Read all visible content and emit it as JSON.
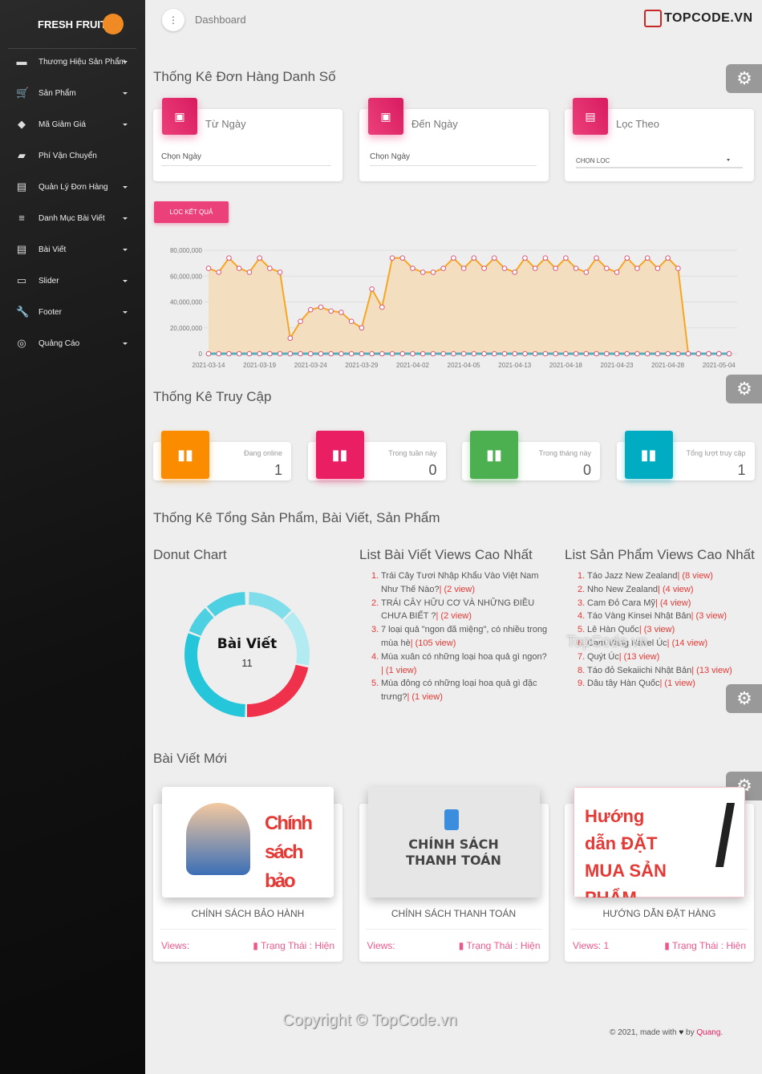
{
  "sidebar": {
    "brand": "FRESH FRUIT",
    "items": [
      {
        "label": "Thương Hiệu Sản Phẩm",
        "icon": "branding-watermark-icon",
        "glyph": "▬",
        "dropdown": true
      },
      {
        "label": "Sản Phẩm",
        "icon": "cart-icon",
        "glyph": "🛒",
        "dropdown": true
      },
      {
        "label": "Mã Giảm Giá",
        "icon": "tag-icon",
        "glyph": "◆",
        "dropdown": true
      },
      {
        "label": "Phí Vận Chuyển",
        "icon": "truck-icon",
        "glyph": "▰",
        "dropdown": false
      },
      {
        "label": "Quản Lý Đơn Hàng",
        "icon": "document-icon",
        "glyph": "▤",
        "dropdown": true
      },
      {
        "label": "Danh Mục Bài Viết",
        "icon": "list-icon",
        "glyph": "≡",
        "dropdown": true
      },
      {
        "label": "Bài Viết",
        "icon": "article-icon",
        "glyph": "▤",
        "dropdown": true
      },
      {
        "label": "Slider",
        "icon": "slider-icon",
        "glyph": "▭",
        "dropdown": true
      },
      {
        "label": "Footer",
        "icon": "wrench-icon",
        "glyph": "🔧",
        "dropdown": true
      },
      {
        "label": "Quảng Cáo",
        "icon": "ads-click-icon",
        "glyph": "◎",
        "dropdown": true
      }
    ]
  },
  "topbar": {
    "menu_glyph": "⋮",
    "title": "Dashboard",
    "watermark_logo": "TOPCODE.VN"
  },
  "orders": {
    "title": "Thống Kê Đơn Hàng Danh Số",
    "from": {
      "label": "Từ Ngày",
      "placeholder": "Chọn Ngày"
    },
    "to": {
      "label": "Đến Ngày",
      "placeholder": "Chọn Ngày"
    },
    "filter": {
      "label": "Lọc Theo",
      "selected": "CHỌN LỌC"
    },
    "button": "LỌC KẾT QUẢ"
  },
  "chart_data": {
    "type": "area",
    "xlim": [
      "2021-03-14",
      "2021-05-04"
    ],
    "ylim": [
      0,
      80000000
    ],
    "yticks": [
      "0",
      "20,000,000",
      "40,000,000",
      "60,000,000",
      "80,000,000"
    ],
    "xticks": [
      "2021-03-14",
      "2021-03-19",
      "2021-03-24",
      "2021-03-29",
      "2021-04-02",
      "2021-04-05",
      "2021-04-13",
      "2021-04-18",
      "2021-04-23",
      "2021-04-28",
      "2021-05-04"
    ],
    "grid": true,
    "colors": [
      "#f5a623",
      "#4fb3bf"
    ],
    "series": [
      {
        "values": [
          66,
          63,
          74,
          66,
          63,
          74,
          66,
          63,
          12,
          25,
          34,
          36,
          33,
          32,
          25,
          20,
          50,
          36,
          74,
          74,
          66,
          63,
          63,
          66,
          74,
          66,
          74,
          66,
          74,
          66,
          63,
          74,
          66,
          74,
          66,
          74,
          66,
          63,
          74,
          66,
          63,
          74,
          66,
          74,
          66,
          74,
          66,
          0,
          0,
          0,
          0,
          0
        ],
        "unit": 1000000
      },
      {
        "values": [
          0,
          0,
          0,
          0,
          0,
          0,
          0,
          0,
          0,
          0,
          0,
          0,
          0,
          0,
          0,
          0,
          0,
          0,
          0,
          0,
          0,
          0,
          0,
          0,
          0,
          0,
          0,
          0,
          0,
          0,
          0,
          0,
          0,
          0,
          0,
          0,
          0,
          0,
          0,
          0,
          0,
          0,
          0,
          0,
          0,
          0,
          0,
          0,
          0,
          0,
          0,
          0
        ],
        "unit": 1000000
      }
    ]
  },
  "access": {
    "title": "Thống Kê Truy Cập",
    "cards": [
      {
        "label": "Đang online",
        "value": "1",
        "color": "#fb8c00"
      },
      {
        "label": "Trong tuần này",
        "value": "0",
        "color": "#e91e63"
      },
      {
        "label": "Trong tháng này",
        "value": "0",
        "color": "#4caf50"
      },
      {
        "label": "Tổng lượt truy cập",
        "value": "1",
        "color": "#00acc1"
      }
    ]
  },
  "totals": {
    "title": "Thống Kê Tổng Sản Phẩm, Bài Viết, Sản Phẩm",
    "donut": {
      "title": "Donut Chart",
      "label": "Bài Viết",
      "value": "11"
    },
    "posts": {
      "title": "List Bài Viết Views Cao Nhất",
      "items": [
        {
          "name": "Trái Cây Tươi Nhập Khẩu Vào Việt Nam Như Thế Nào?",
          "views": "| (2 view)"
        },
        {
          "name": "TRÁI CÂY HỮU CƠ VÀ NHỮNG ĐIỀU CHƯA BIẾT ?",
          "views": "| (2 view)"
        },
        {
          "name": "7 loại quả \"ngon đã miệng\", có nhiều trong mùa hè",
          "views": "| (105 view)"
        },
        {
          "name": "Mùa xuân có những loại hoa quả gì ngon?",
          "views": "| (1 view)"
        },
        {
          "name": "Mùa đông có những loại hoa quả gì đặc trưng?",
          "views": "| (1 view)"
        }
      ]
    },
    "products": {
      "title": "List Sản Phẩm Views Cao Nhất",
      "items": [
        {
          "name": "Táo Jazz New Zealand",
          "views": "| (8 view)"
        },
        {
          "name": "Nho New Zealand",
          "views": "| (4 view)"
        },
        {
          "name": "Cam Đỏ Cara Mỹ",
          "views": "| (4 view)"
        },
        {
          "name": "Táo Vàng Kinsei Nhật Bản",
          "views": "| (3 view)"
        },
        {
          "name": "Lê Hàn Quốc",
          "views": "| (3 view)"
        },
        {
          "name": "Cam Vàng Navel Úc",
          "views": "| (14 view)"
        },
        {
          "name": "Quýt Úc",
          "views": "| (13 view)"
        },
        {
          "name": "Táo đỏ Sekaiichi Nhật Bản",
          "views": "| (13 view)"
        },
        {
          "name": "Dâu tây Hàn Quốc",
          "views": "| (1 view)"
        }
      ]
    },
    "watermark": "TopCode.vn"
  },
  "new_posts": {
    "title": "Bài Viết Mới",
    "items": [
      {
        "title": "CHÍNH SÁCH BẢO HÀNH",
        "views": "Views:",
        "status": "Trạng Thái : Hiện",
        "image_text": "Chính sách bảo hành"
      },
      {
        "title": "CHÍNH SÁCH THANH TOÁN",
        "views": "Views:",
        "status": "Trạng Thái : Hiện",
        "image_text": "CHÍNH SÁCH THANH TOÁN"
      },
      {
        "title": "HƯỚNG DẪN ĐẶT HÀNG",
        "views": "Views: 1",
        "status": "Trạng Thái : Hiện",
        "image_text": "Hướng dẫn ĐẶT MUA SẢN PHẨM"
      }
    ]
  },
  "footer": {
    "copyright": "Copyright © TopCode.vn",
    "made": "© 2021, made with",
    "heart": "♥",
    "by": "by",
    "author": "Quang",
    "dot": "."
  }
}
